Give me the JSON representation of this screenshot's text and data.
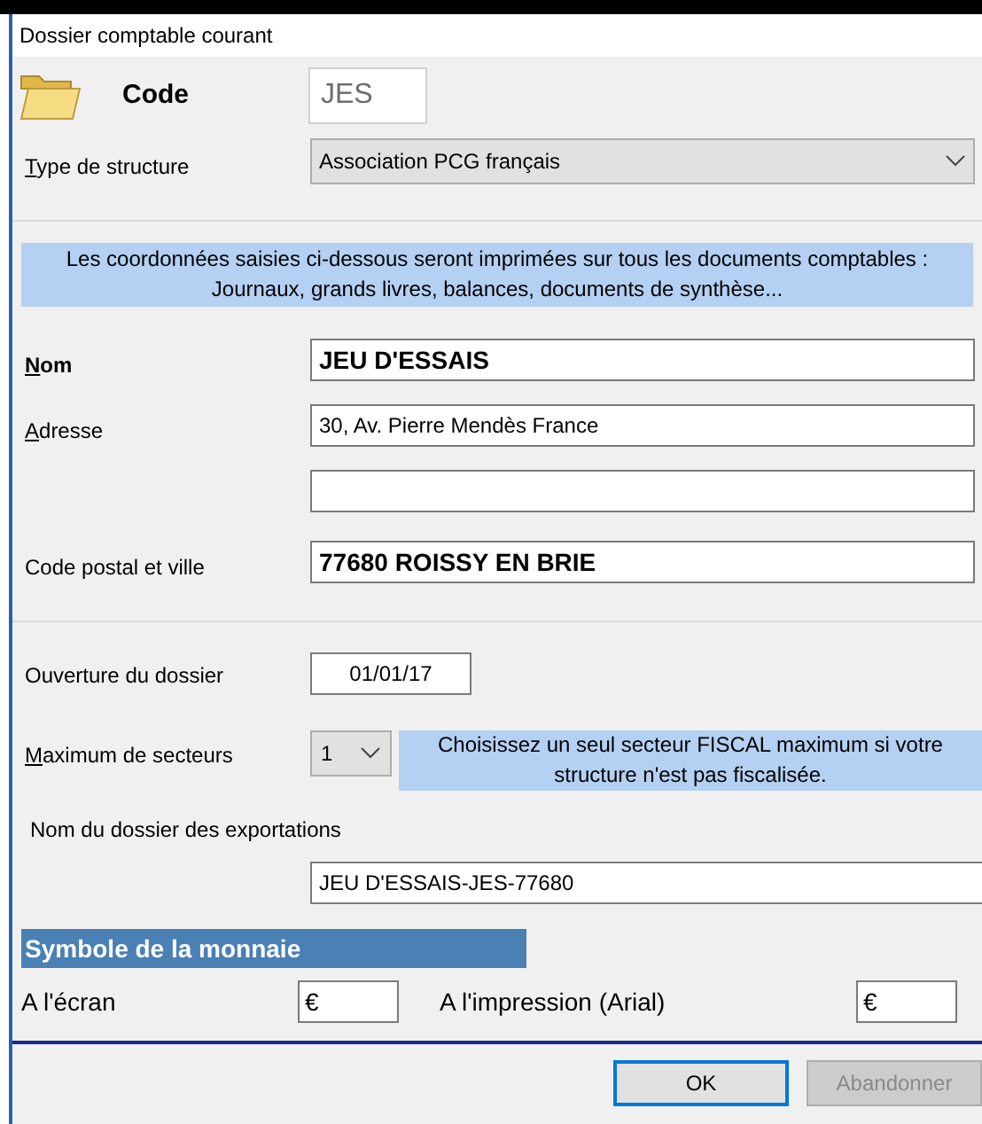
{
  "window": {
    "title": "Dossier comptable courant"
  },
  "code": {
    "label": "Code",
    "value": "JES"
  },
  "structure": {
    "label": "Type de structure",
    "mnemonic": true,
    "value": "Association PCG français"
  },
  "info": "Les coordonnées saisies ci-dessous seront imprimées sur tous les documents comptables : Journaux, grands livres, balances, documents de synthèse...",
  "address_fields": [
    {
      "kind": "text",
      "label": "Nom",
      "mnemonic": true,
      "bold_label": true,
      "value": "JEU D'ESSAIS",
      "bold_value": true
    },
    {
      "kind": "text",
      "label": "Adresse",
      "mnemonic": true,
      "bold_label": false,
      "value": "30, Av. Pierre Mendès France",
      "bold_value": false
    },
    {
      "kind": "blank"
    },
    {
      "kind": "text",
      "label": "Code postal et ville",
      "mnemonic": false,
      "bold_label": false,
      "value": "77680 ROISSY EN BRIE",
      "bold_value": true
    }
  ],
  "opening": {
    "label": "Ouverture du dossier",
    "value": "01/01/17"
  },
  "sectors": {
    "label": "Maximum de secteurs",
    "mnemonic": true,
    "value": "1",
    "hint": "Choisissez un seul secteur FISCAL maximum si votre structure n'est pas fiscalisée."
  },
  "export": {
    "label": "Nom du dossier des exportations",
    "value": "JEU D'ESSAIS-JES-77680"
  },
  "currency": {
    "heading": "Symbole de la monnaie",
    "screen_label": "A l'écran",
    "screen_value": "€",
    "print_label": "A l'impression (Arial)",
    "print_value": "€"
  },
  "buttons": [
    {
      "label": "OK",
      "default": true,
      "disabled": false
    },
    {
      "label": "Abandonner",
      "default": false,
      "disabled": true
    }
  ]
}
